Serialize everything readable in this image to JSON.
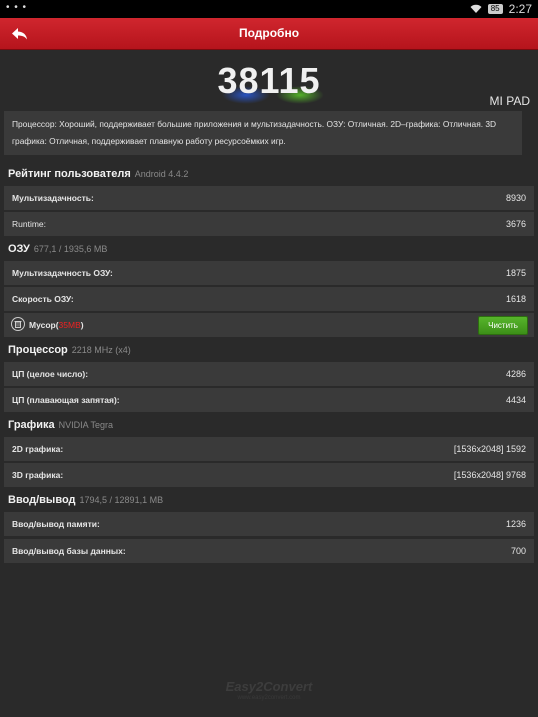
{
  "status_bar": {
    "battery": "85",
    "time": "2:27"
  },
  "app_bar": {
    "title": "Подробно"
  },
  "score": {
    "value": "38115",
    "device": "MI PAD"
  },
  "description": "Процессор: Хороший, поддерживает большие приложения и мультизадачность. ОЗУ: Отличная. 2D–графика: Отличная. 3D графика: Отличная, поддерживает плавную работу ресурсоёмких игр.",
  "user_rating": {
    "title": "Рейтинг пользователя",
    "subtitle": "Android 4.4.2",
    "multitasking_label": "Мультизадачность:",
    "multitasking_value": "8930",
    "runtime_label": "Runtime:",
    "runtime_value": "3676"
  },
  "ram": {
    "title": "ОЗУ",
    "subtitle": "677,1 / 1935,6 MB",
    "multitasking_label": "Мультизадачность ОЗУ:",
    "multitasking_value": "1875",
    "speed_label": "Скорость ОЗУ:",
    "speed_value": "1618",
    "junk_label": "Мусор(",
    "junk_value": "35MB",
    "junk_close": ")",
    "clean_button": "Чистить"
  },
  "cpu": {
    "title": "Процессор",
    "subtitle": "2218 MHz (x4)",
    "integer_label": "ЦП (целое число):",
    "integer_value": "4286",
    "float_label": "ЦП (плавающая запятая):",
    "float_value": "4434"
  },
  "graphics": {
    "title": "Графика",
    "subtitle": "NVIDIA Tegra",
    "g2d_label": "2D графика:",
    "g2d_value": "[1536x2048] 1592",
    "g3d_label": "3D графика:",
    "g3d_value": "[1536x2048] 9768"
  },
  "io": {
    "title": "Ввод/вывод",
    "subtitle": "1794,5 / 12891,1 MB",
    "memory_label": "Ввод/вывод памяти:",
    "memory_value": "1236",
    "db_label": "Ввод/вывод базы данных:",
    "db_value": "700"
  },
  "watermark": {
    "brand": "Easy2Convert",
    "url": "www.easy2convert.com"
  },
  "colors": {
    "appbar": "#c41d25",
    "accent_green": "#4aa321",
    "junk_red": "#e22222"
  }
}
